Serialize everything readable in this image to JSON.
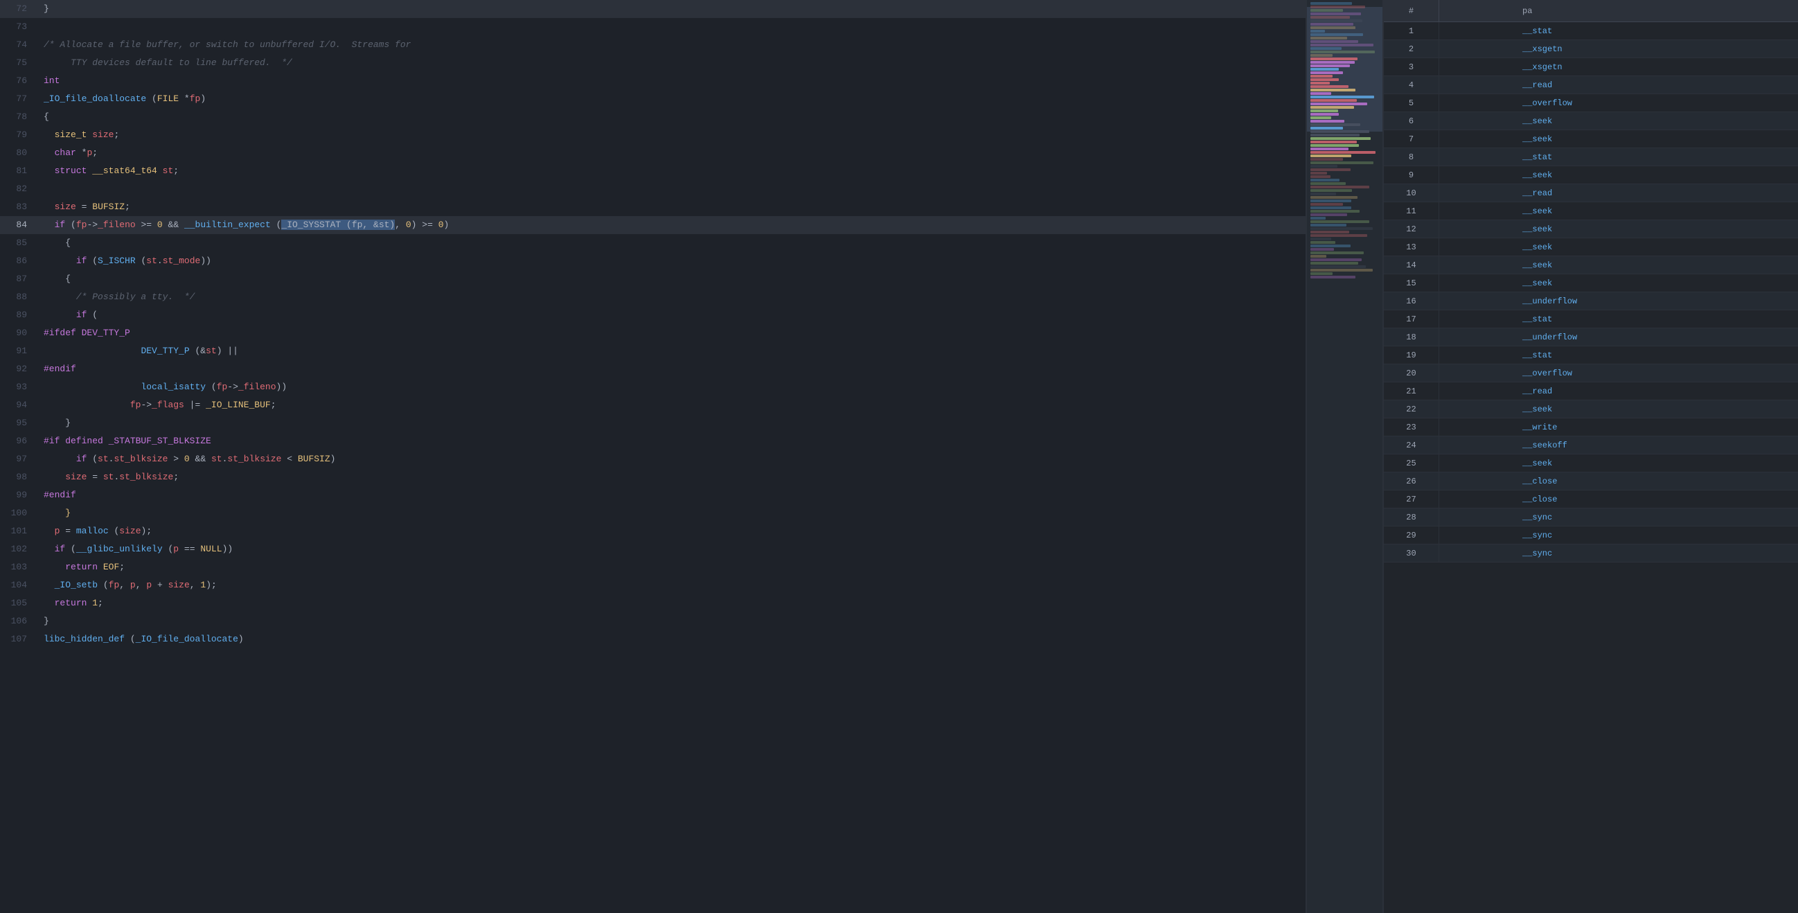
{
  "code": {
    "lines": [
      {
        "num": 72,
        "content": "}",
        "type": "plain"
      },
      {
        "num": 73,
        "content": "",
        "type": "plain"
      },
      {
        "num": 74,
        "content": "/* Allocate a file buffer, or switch to unbuffered I/O.  Streams for",
        "type": "comment"
      },
      {
        "num": 75,
        "content": "     TTY devices default to line buffered.  */",
        "type": "comment"
      },
      {
        "num": 76,
        "content": "int",
        "type": "keyword_line"
      },
      {
        "num": 77,
        "content": "_IO_file_doallocate (FILE *fp)",
        "type": "fn_line"
      },
      {
        "num": 78,
        "content": "{",
        "type": "plain"
      },
      {
        "num": 79,
        "content": "  size_t size;",
        "type": "plain"
      },
      {
        "num": 80,
        "content": "  char *p;",
        "type": "plain"
      },
      {
        "num": 81,
        "content": "  struct __stat64_t64 st;",
        "type": "plain"
      },
      {
        "num": 82,
        "content": "",
        "type": "plain"
      },
      {
        "num": 83,
        "content": "  size = BUFSIZ;",
        "type": "plain"
      },
      {
        "num": 84,
        "content": "  if (fp->_fileno >= 0 && __builtin_expect (_IO_SYSSTAT (fp, &st), 0) >= 0)",
        "type": "highlight"
      },
      {
        "num": 85,
        "content": "    {",
        "type": "plain"
      },
      {
        "num": 86,
        "content": "      if (S_ISCHR (st.st_mode))",
        "type": "plain"
      },
      {
        "num": 87,
        "content": "    {",
        "type": "plain"
      },
      {
        "num": 88,
        "content": "      /* Possibly a tty.  */",
        "type": "comment"
      },
      {
        "num": 89,
        "content": "      if (",
        "type": "plain"
      },
      {
        "num": 90,
        "content": "#ifdef DEV_TTY_P",
        "type": "preprocessor"
      },
      {
        "num": 91,
        "content": "\t\t  DEV_TTY_P (&st) ||",
        "type": "plain"
      },
      {
        "num": 92,
        "content": "#endif",
        "type": "preprocessor"
      },
      {
        "num": 93,
        "content": "\t\t  local_isatty (fp->_fileno))",
        "type": "plain"
      },
      {
        "num": 94,
        "content": "\t\tfp->_flags |= _IO_LINE_BUF;",
        "type": "plain"
      },
      {
        "num": 95,
        "content": "    }",
        "type": "plain"
      },
      {
        "num": 96,
        "content": "#if defined _STATBUF_ST_BLKSIZE",
        "type": "preprocessor"
      },
      {
        "num": 97,
        "content": "      if (st.st_blksize > 0 && st.st_blksize < BUFSIZ)",
        "type": "plain"
      },
      {
        "num": 98,
        "content": "    size = st.st_blksize;",
        "type": "plain"
      },
      {
        "num": 99,
        "content": "#endif",
        "type": "preprocessor"
      },
      {
        "num": 100,
        "content": "    }",
        "type": "brace_indent"
      },
      {
        "num": 101,
        "content": "  p = malloc (size);",
        "type": "plain"
      },
      {
        "num": 102,
        "content": "  if (__glibc_unlikely (p == NULL))",
        "type": "plain"
      },
      {
        "num": 103,
        "content": "    return EOF;",
        "type": "plain"
      },
      {
        "num": 104,
        "content": "  _IO_setb (fp, p, p + size, 1);",
        "type": "plain"
      },
      {
        "num": 105,
        "content": "  return 1;",
        "type": "plain"
      },
      {
        "num": 106,
        "content": "}",
        "type": "plain"
      },
      {
        "num": 107,
        "content": "libc_hidden_def (_IO_file_doallocate)",
        "type": "plain"
      }
    ]
  },
  "right_table": {
    "header": {
      "col_hash": "#",
      "col_pa": "pa"
    },
    "rows": [
      {
        "num": 1,
        "name": "__stat"
      },
      {
        "num": 2,
        "name": "__xsgetn"
      },
      {
        "num": 3,
        "name": "__xsgetn"
      },
      {
        "num": 4,
        "name": "__read"
      },
      {
        "num": 5,
        "name": "__overflow"
      },
      {
        "num": 6,
        "name": "__seek"
      },
      {
        "num": 7,
        "name": "__seek"
      },
      {
        "num": 8,
        "name": "__stat"
      },
      {
        "num": 9,
        "name": "__seek"
      },
      {
        "num": 10,
        "name": "__read"
      },
      {
        "num": 11,
        "name": "__seek"
      },
      {
        "num": 12,
        "name": "__seek"
      },
      {
        "num": 13,
        "name": "__seek"
      },
      {
        "num": 14,
        "name": "__seek"
      },
      {
        "num": 15,
        "name": "__seek"
      },
      {
        "num": 16,
        "name": "__underflow"
      },
      {
        "num": 17,
        "name": "__stat"
      },
      {
        "num": 18,
        "name": "__underflow"
      },
      {
        "num": 19,
        "name": "__stat"
      },
      {
        "num": 20,
        "name": "__overflow"
      },
      {
        "num": 21,
        "name": "__read"
      },
      {
        "num": 22,
        "name": "__seek"
      },
      {
        "num": 23,
        "name": "__write"
      },
      {
        "num": 24,
        "name": "__seekoff"
      },
      {
        "num": 25,
        "name": "__seek"
      },
      {
        "num": 26,
        "name": "__close"
      },
      {
        "num": 27,
        "name": "__close"
      },
      {
        "num": 28,
        "name": "__sync"
      },
      {
        "num": 29,
        "name": "__sync"
      },
      {
        "num": 30,
        "name": "__sync"
      }
    ]
  }
}
